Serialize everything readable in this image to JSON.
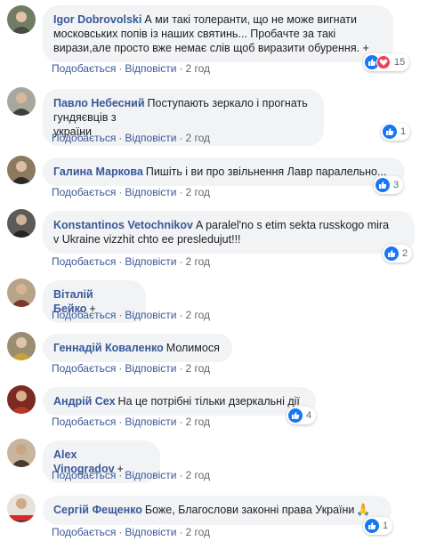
{
  "actions": {
    "like": "Подобається",
    "reply": "Відповісти",
    "separator": "·"
  },
  "colors": {
    "author": "#385898",
    "bubble": "#f2f3f5",
    "like": "#1877f2",
    "love": "#f33e58",
    "meta": "#606770"
  },
  "comments": [
    {
      "author": "Igor Dobrovolski",
      "line1": "А ми такі толеранти, що не може вигнати",
      "line2": "московських попів із наших святинь... Пробачте за такі",
      "line3": "вирази,але просто вже немає слів щоб виразити обурення. +",
      "time": "2 год",
      "reaction_count": "15",
      "reactions": [
        "like-icon",
        "love-icon"
      ]
    },
    {
      "author": "Павло Небесний",
      "line1": "Поступають зеркало і прогнать гундяєвців з",
      "line2": "україни",
      "time": "2 год",
      "reaction_count": "1",
      "reactions": [
        "like-icon"
      ]
    },
    {
      "author": "Галина Маркова",
      "line1": "Пишіть і ви про звільнення Лавр паралельно...",
      "time": "2 год",
      "reaction_count": "3",
      "reactions": [
        "like-icon"
      ]
    },
    {
      "author": "Konstantinos Vetochnikov",
      "line1": "A paralel'no s etim sekta russkogo mira",
      "line2": "v Ukraine vizzhit chto ee presledujut!!!",
      "time": "2 год",
      "reaction_count": "2",
      "reactions": [
        "like-icon"
      ]
    },
    {
      "author": "Віталій Бейко",
      "line1": "+",
      "time": "2 год"
    },
    {
      "author": "Геннадій Коваленко",
      "line1": "Молимося",
      "time": "2 год"
    },
    {
      "author": "Андрій Сех",
      "line1": "На це потрібні тільки дзеркальні дії",
      "time": "2 год",
      "reaction_count": "4",
      "reactions": [
        "like-icon"
      ]
    },
    {
      "author": "Alex Vinogradov",
      "line1": "+",
      "time": "2 год"
    },
    {
      "author": "Сергій Фещенко",
      "line1": "Боже, Благослови законні права України",
      "time": "2 год",
      "reaction_count": "1",
      "reactions": [
        "like-icon"
      ],
      "emoji": "🙏"
    }
  ]
}
